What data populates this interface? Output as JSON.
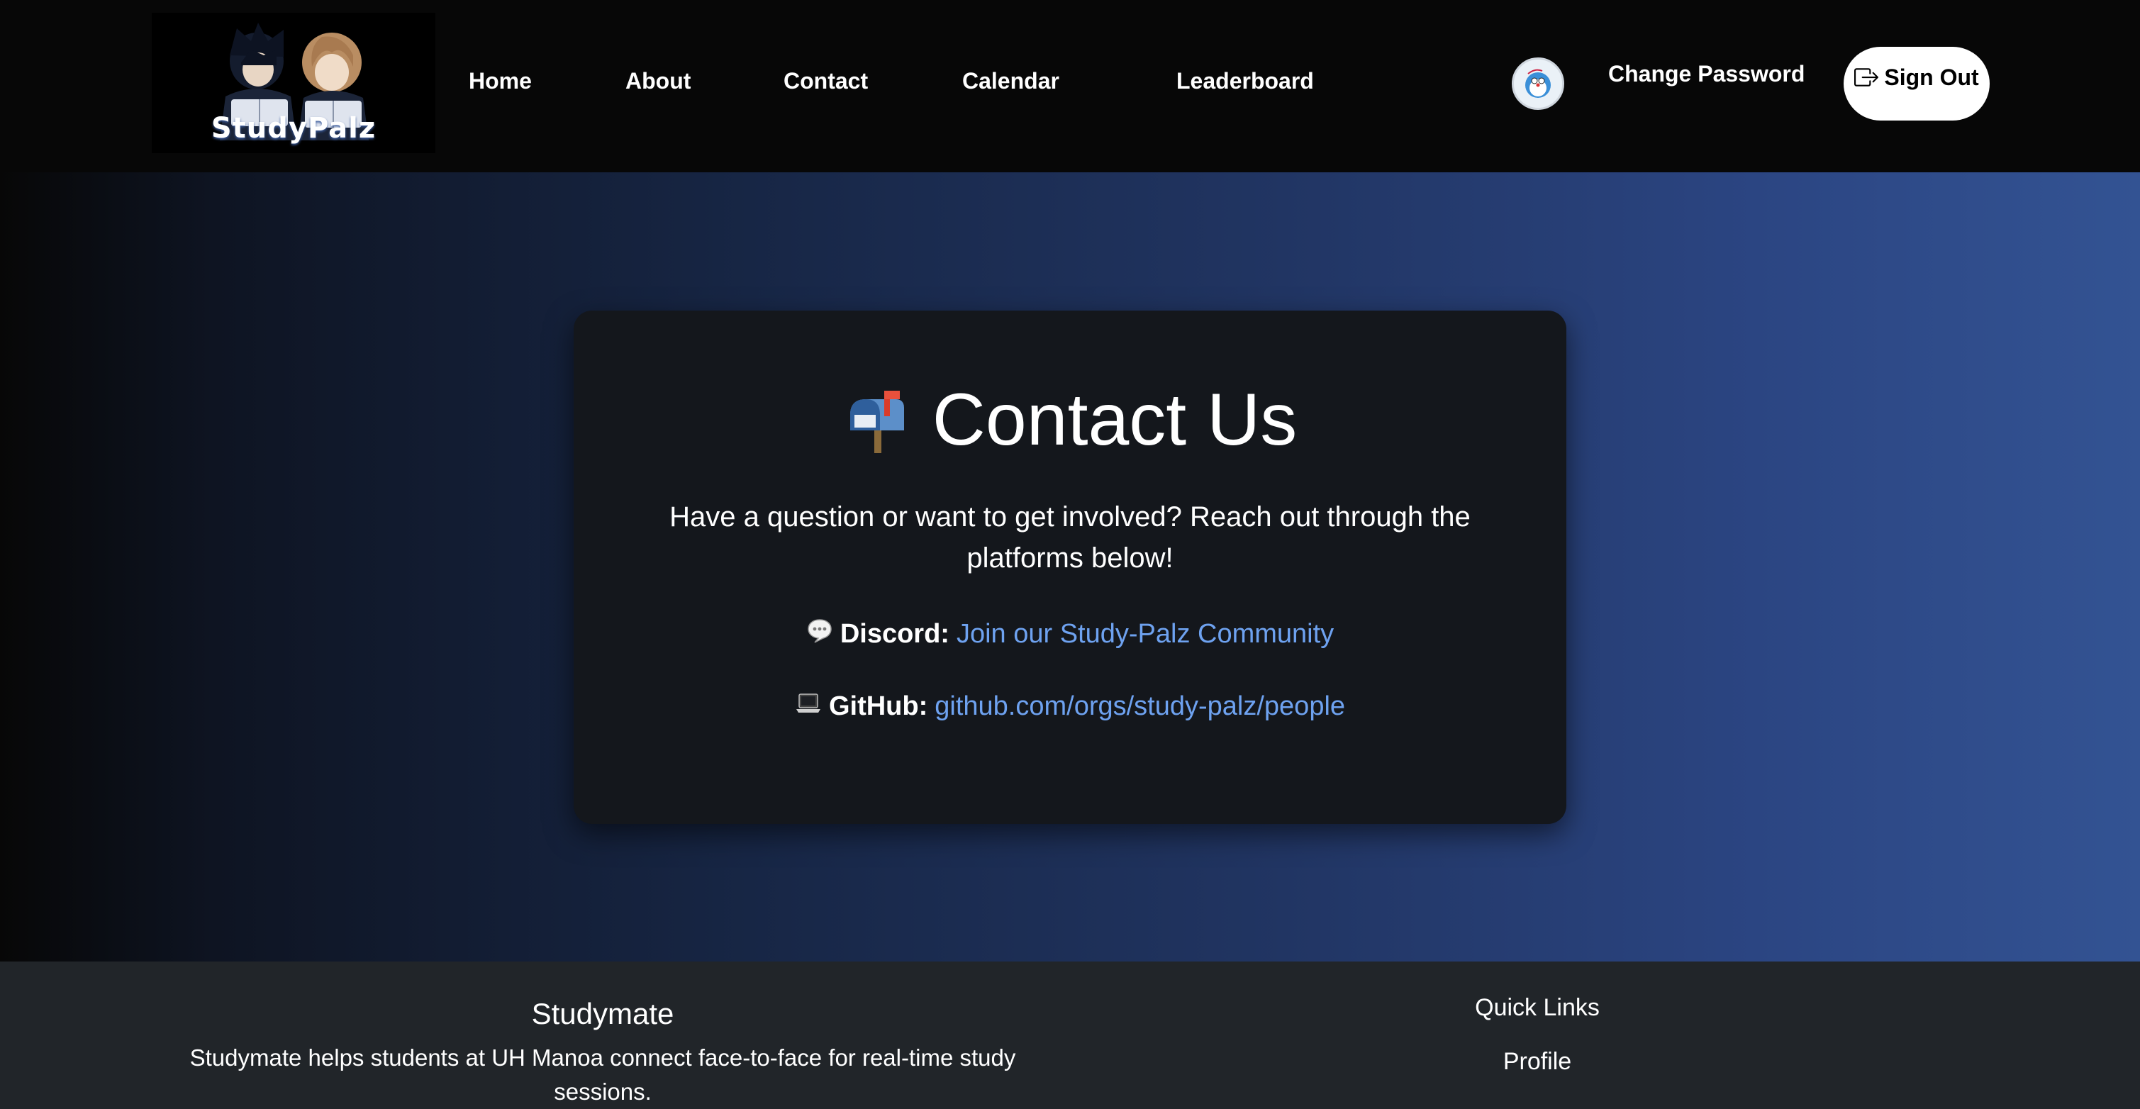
{
  "navbar": {
    "logo_text": "StudyPalz",
    "links": [
      "Home",
      "About",
      "Contact",
      "Calendar",
      "Leaderboard"
    ],
    "change_password": "Change Password",
    "sign_out": "Sign Out",
    "icons": {
      "avatar": "avatar",
      "sign_out": "box-arrow-right-icon"
    }
  },
  "contact": {
    "title": "Contact Us",
    "title_icon": "mailbox-icon",
    "description": "Have a question or want to get involved? Reach out through the platforms below!",
    "discord": {
      "icon": "speech-balloon-icon",
      "label": "Discord:",
      "link_text": "Join our Study-Palz Community"
    },
    "github": {
      "icon": "laptop-icon",
      "label": "GitHub:",
      "link_text": "github.com/orgs/study-palz/people"
    }
  },
  "footer": {
    "brand": "Studymate",
    "description": "Studymate helps students at UH Manoa connect face-to-face for real-time study sessions.",
    "quick_links_title": "Quick Links",
    "quick_links": [
      "Profile"
    ]
  },
  "colors": {
    "link": "#6ea2f0",
    "card": "#14171c",
    "footer": "#212529",
    "gradient_end": "#335393"
  }
}
